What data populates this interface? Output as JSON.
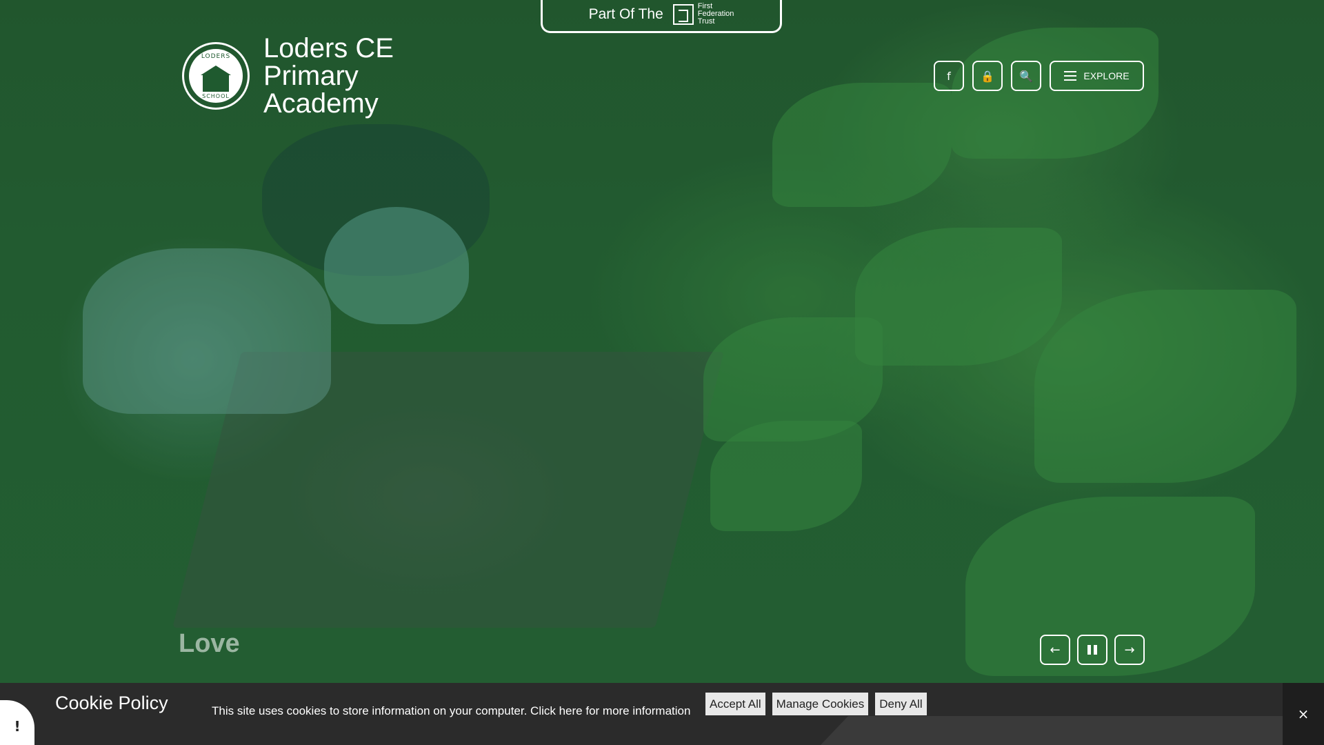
{
  "trust_banner": {
    "prefix": "Part Of The",
    "trust_name_lines": [
      "First",
      "Federation",
      "Trust"
    ]
  },
  "brand": {
    "title": "Loders CE Primary Academy",
    "crest_top": "LODERS",
    "crest_bottom": "SCHOOL"
  },
  "nav": {
    "facebook_icon": "f",
    "lock_icon": "🔒",
    "search_icon": "🔍",
    "explore_label": "EXPLORE"
  },
  "hero": {
    "slide_word": "Love"
  },
  "slider": {
    "prev_icon": "←",
    "next_icon": "→"
  },
  "cookie": {
    "title": "Cookie Policy",
    "text": "This site uses cookies to store information on your computer. Click here for more information",
    "accept_label": "Accept All",
    "manage_label": "Manage Cookies",
    "deny_label": "Deny All",
    "close_icon": "×",
    "alert_icon": "!"
  },
  "colors": {
    "brand_green": "#1f5a2f",
    "cookie_bg": "#2b2b2b"
  }
}
